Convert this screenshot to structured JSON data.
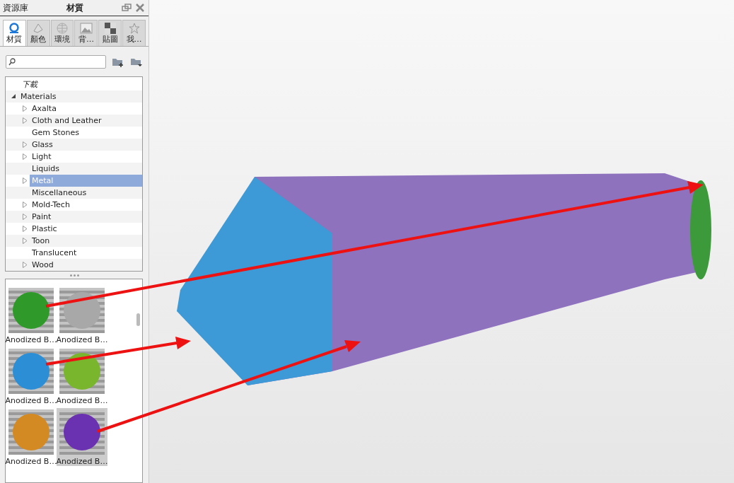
{
  "panel": {
    "title": "資源庫",
    "subtitle": "材質"
  },
  "tabs": [
    {
      "label": "材質",
      "selected": true
    },
    {
      "label": "顏色",
      "selected": false
    },
    {
      "label": "環境",
      "selected": false
    },
    {
      "label": "背…",
      "selected": false
    },
    {
      "label": "貼圖",
      "selected": false
    },
    {
      "label": "我…",
      "selected": false
    }
  ],
  "tree": [
    {
      "label": "下載",
      "kind": "download",
      "expandable": false,
      "selected": false
    },
    {
      "label": "Materials",
      "kind": "folder",
      "expandable": true,
      "expanded": true,
      "selected": false,
      "children": [
        {
          "label": "Axalta",
          "expandable": true,
          "selected": false
        },
        {
          "label": "Cloth and Leather",
          "expandable": true,
          "selected": false
        },
        {
          "label": "Gem Stones",
          "expandable": false,
          "selected": false
        },
        {
          "label": "Glass",
          "expandable": true,
          "selected": false
        },
        {
          "label": "Light",
          "expandable": true,
          "selected": false
        },
        {
          "label": "Liquids",
          "expandable": false,
          "selected": false
        },
        {
          "label": "Metal",
          "expandable": true,
          "selected": true
        },
        {
          "label": "Miscellaneous",
          "expandable": false,
          "selected": false
        },
        {
          "label": "Mold-Tech",
          "expandable": true,
          "selected": false
        },
        {
          "label": "Paint",
          "expandable": true,
          "selected": false
        },
        {
          "label": "Plastic",
          "expandable": true,
          "selected": false
        },
        {
          "label": "Toon",
          "expandable": true,
          "selected": false
        },
        {
          "label": "Translucent",
          "expandable": false,
          "selected": false
        },
        {
          "label": "Wood",
          "expandable": true,
          "selected": false
        }
      ]
    }
  ],
  "thumbnails": [
    {
      "label": "Anodized B…",
      "color": "#2f9a2a",
      "selected": false
    },
    {
      "label": "Anodized B…",
      "color": "#a8a8a8",
      "selected": false
    },
    {
      "label": "Anodized B…",
      "color": "#2c8fd6",
      "selected": false
    },
    {
      "label": "Anodized B…",
      "color": "#7ab52e",
      "selected": false
    },
    {
      "label": "Anodized B…",
      "color": "#d48a22",
      "selected": false
    },
    {
      "label": "Anodized B…",
      "color": "#6a32b0",
      "selected": true
    }
  ]
}
